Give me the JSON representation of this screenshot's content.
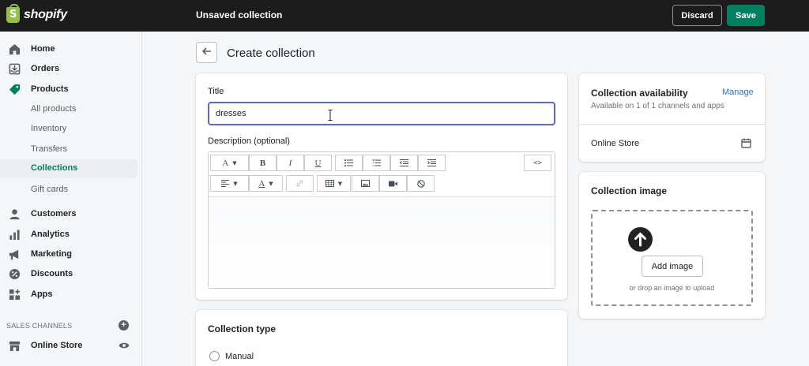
{
  "topbar": {
    "brand": "shopify",
    "status": "Unsaved collection",
    "discard_label": "Discard",
    "save_label": "Save",
    "accent": "#008060"
  },
  "sidebar": {
    "items": [
      {
        "label": "Home",
        "icon": "home-icon"
      },
      {
        "label": "Orders",
        "icon": "orders-icon"
      },
      {
        "label": "Products",
        "icon": "tag-icon"
      },
      {
        "label": "All products"
      },
      {
        "label": "Inventory"
      },
      {
        "label": "Transfers"
      },
      {
        "label": "Collections",
        "active": true
      },
      {
        "label": "Gift cards"
      },
      {
        "label": "Customers",
        "icon": "person-icon"
      },
      {
        "label": "Analytics",
        "icon": "bar-chart-icon"
      },
      {
        "label": "Marketing",
        "icon": "megaphone-icon"
      },
      {
        "label": "Discounts",
        "icon": "discount-icon"
      },
      {
        "label": "Apps",
        "icon": "apps-icon"
      }
    ],
    "sales_channels_label": "SALES CHANNELS",
    "channel": {
      "label": "Online Store",
      "icon": "store-icon"
    }
  },
  "main": {
    "page_title": "Create collection",
    "title_label": "Title",
    "title_value": "dresses",
    "description_label": "Description (optional)",
    "toolbar_row1": [
      "A",
      "B",
      "I",
      "U",
      "bulleted-list",
      "numbered-list",
      "outdent",
      "indent",
      "html"
    ],
    "toolbar_row2": [
      "align",
      "text-color",
      "link",
      "table",
      "image",
      "video",
      "clear-format"
    ],
    "collection_type_title": "Collection type",
    "manual_label": "Manual"
  },
  "availability": {
    "title": "Collection availability",
    "manage_label": "Manage",
    "subtitle": "Available on 1 of 1 channels and apps",
    "channel": "Online Store"
  },
  "image": {
    "title": "Collection image",
    "add_button": "Add image",
    "hint": "or drop an image to upload"
  }
}
